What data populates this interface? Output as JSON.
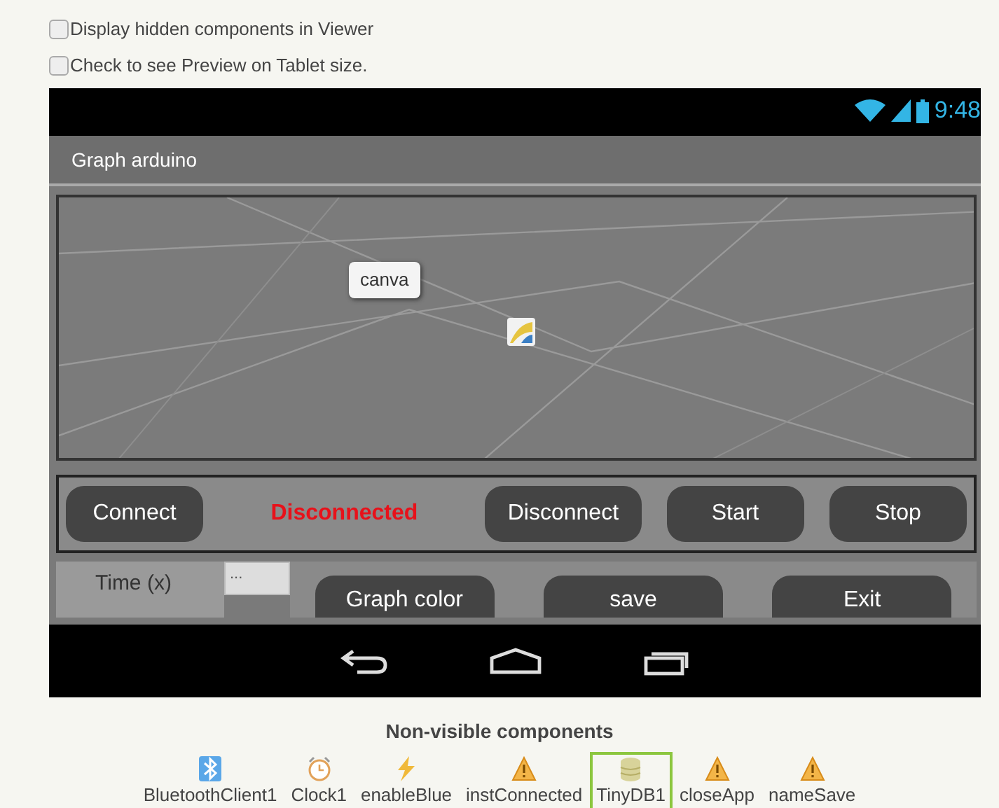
{
  "options": [
    {
      "label": "Display hidden components in Viewer",
      "checked": false
    },
    {
      "label": "Check to see Preview on Tablet size.",
      "checked": false
    }
  ],
  "phone": {
    "status_time": "9:48",
    "title": "Graph arduino",
    "canvas": {
      "tooltip": "canva"
    },
    "control_row": [
      {
        "kind": "button",
        "text": "Connect"
      },
      {
        "kind": "status",
        "text": "Disconnected"
      },
      {
        "kind": "button",
        "text": "Disconnect"
      },
      {
        "kind": "button",
        "text": "Start"
      },
      {
        "kind": "button",
        "text": "Stop"
      }
    ],
    "bottom_row": {
      "label": "Time (x)",
      "field_value": "...",
      "buttons": [
        "Graph color",
        "save",
        "Exit"
      ]
    }
  },
  "non_visible": {
    "heading": "Non-visible components",
    "items": [
      {
        "kind": "bluetooth",
        "label": "BluetoothClient1",
        "selected": false
      },
      {
        "kind": "clock",
        "label": "Clock1",
        "selected": false
      },
      {
        "kind": "lightning",
        "label": "enableBlue",
        "selected": false
      },
      {
        "kind": "warning",
        "label": "instConnected",
        "selected": false
      },
      {
        "kind": "database",
        "label": "TinyDB1",
        "selected": true
      },
      {
        "kind": "warning",
        "label": "closeApp",
        "selected": false
      },
      {
        "kind": "warning",
        "label": "nameSave",
        "selected": false
      }
    ]
  }
}
